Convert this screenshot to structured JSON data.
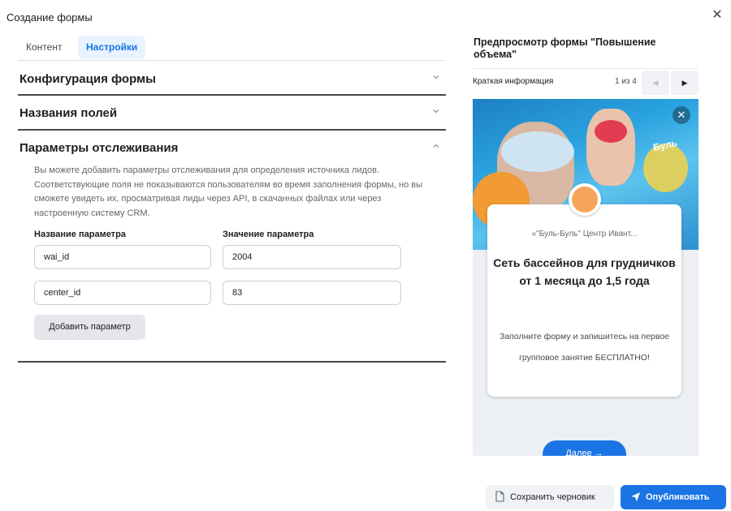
{
  "dialog": {
    "title": "Создание формы",
    "close_glyph": "✕"
  },
  "tabs": [
    {
      "label": "Контент",
      "active": false
    },
    {
      "label": "Настройки",
      "active": true
    }
  ],
  "sections": [
    {
      "title": "Конфигурация формы",
      "expanded": false,
      "icon": "chevron-down-icon"
    },
    {
      "title": "Названия полей",
      "expanded": false,
      "icon": "chevron-down-icon"
    },
    {
      "title": "Параметры отслеживания",
      "expanded": true,
      "icon": "chevron-up-icon"
    }
  ],
  "tracking": {
    "description": "Вы можете добавить параметры отслеживания для определения источника лидов. Соответствующие поля не показываются пользователям во время заполнения формы, но вы сможете увидеть их, просматривая лиды через API, в скачанных файлах или через настроенную систему CRM.",
    "name_header": "Название параметра",
    "value_header": "Значение параметра",
    "rows": [
      {
        "name": "wai_id",
        "value": "2004"
      },
      {
        "name": "center_id",
        "value": "83"
      }
    ],
    "add_button": "Добавить параметр"
  },
  "preview": {
    "title": "Предпросмотр формы \"Повышение объема\"",
    "section_label": "Краткая информация",
    "counter": "1 из 4",
    "image_logo_text": "Буль",
    "page_name": "«\"Буль-Буль\" Центр Ивант...",
    "headline": "Сеть бассейнов для грудничков от 1 месяца до 1,5 года",
    "body": "Заполните форму и запишитесь на первое групповое занятие БЕСПЛАТНО!",
    "next_button": "Далее"
  },
  "footer": {
    "draft_button": "Сохранить черновик",
    "publish_button": "Опубликовать"
  },
  "colors": {
    "accent": "#1b74e4",
    "tab_active_bg": "#e7f3ff",
    "divider": "#444950",
    "button_gray": "#e4e6eb"
  }
}
